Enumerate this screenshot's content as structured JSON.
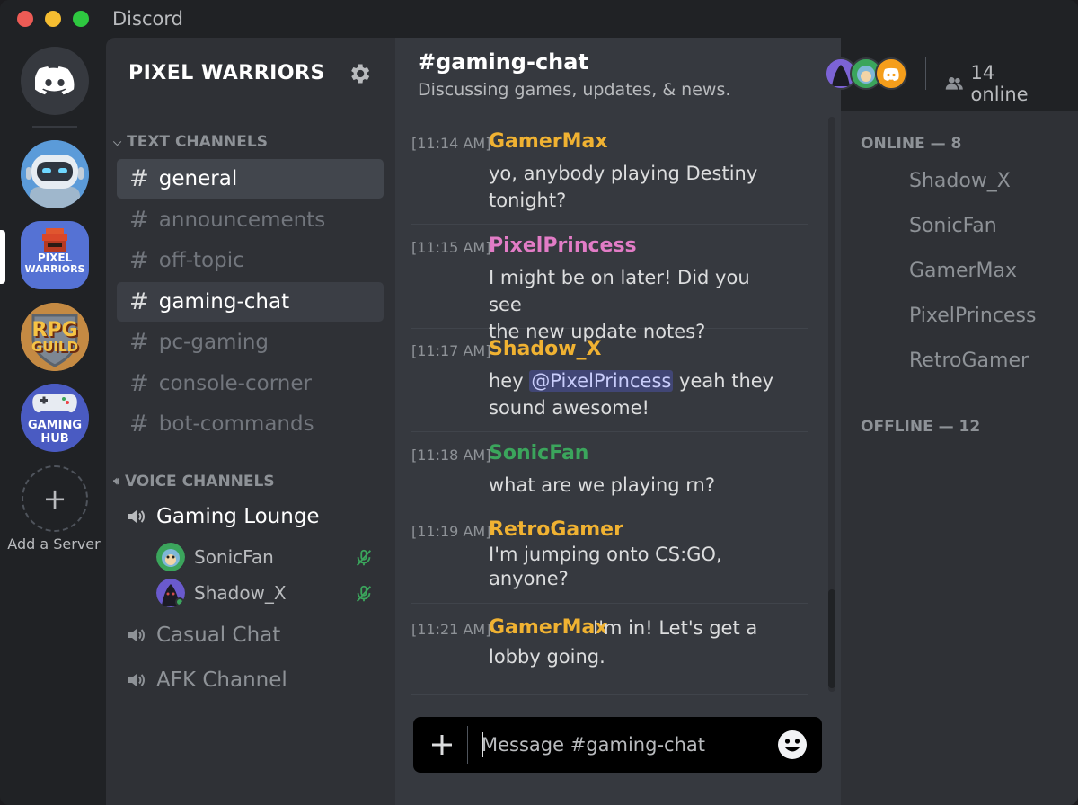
{
  "titlebar": {
    "app_title": "Discord"
  },
  "servers": {
    "pixel_label_1": "PIXEL",
    "pixel_label_2": "WARRIORS",
    "rpg_label_1": "RPG",
    "rpg_label_2": "GUILD",
    "hub_label_1": "GAMING",
    "hub_label_2": "HUB",
    "add_label": "Add a Server"
  },
  "guild": {
    "name": "PIXEL WARRIORS"
  },
  "categories": {
    "text": "TEXT CHANNELS",
    "voice": "VOICE CHANNELS"
  },
  "text_channels": [
    {
      "name": "general",
      "state": "selected"
    },
    {
      "name": "announcements",
      "state": "muted"
    },
    {
      "name": "off-topic",
      "state": "muted"
    },
    {
      "name": "gaming-chat",
      "state": "active"
    },
    {
      "name": "pc-gaming",
      "state": "muted"
    },
    {
      "name": "console-corner",
      "state": "muted"
    },
    {
      "name": "bot-commands",
      "state": "muted"
    }
  ],
  "voice_channels": [
    {
      "name": "Gaming Lounge",
      "users": [
        "SonicFan",
        "Shadow_X"
      ]
    },
    {
      "name": "Casual Chat"
    },
    {
      "name": "AFK Channel"
    }
  ],
  "chat": {
    "title": "#gaming-chat",
    "topic": "Discussing games, updates, & news.",
    "online_count": "14 online",
    "messages": [
      {
        "time": "[11:14 AM]",
        "author": "GamerMax",
        "color": "#f0b232",
        "lines": [
          "yo, anybody playing Destiny",
          "tonight?"
        ]
      },
      {
        "time": "[11:15 AM]",
        "author": "PixelPrincess",
        "color": "#e27cc6",
        "lines": [
          "I might be on later! Did you see",
          "the new update notes?"
        ]
      },
      {
        "time": "[11:17 AM]",
        "author": "Shadow_X",
        "color": "#f0b232",
        "before_mention": "hey ",
        "mention": "@PixelPrincess",
        "after_mention": " yeah they",
        "line2": "sound awesome!"
      },
      {
        "time": "[11:18 AM]",
        "author": "SonicFan",
        "color": "#3ba55c",
        "lines": [
          "what are we playing rn?"
        ]
      },
      {
        "time": "[11:19 AM]",
        "author": "RetroGamer",
        "color": "#f0b232",
        "lines": [
          "I'm jumping onto CS:GO,",
          "anyone?"
        ]
      },
      {
        "time": "[11:21 AM]",
        "author": "GamerMax",
        "color": "#f0b232",
        "inline": "I'm in! Let's get a",
        "line2": "lobby going."
      }
    ],
    "composer_placeholder": "Message #gaming-chat"
  },
  "members": {
    "online_header": "ONLINE — 8",
    "online": [
      "Shadow_X",
      "SonicFan",
      "GamerMax",
      "PixelPrincess",
      "RetroGamer"
    ],
    "offline_header": "OFFLINE — 12"
  },
  "colors": {
    "mention_bg": "#414675",
    "online_green": "#3ba55c",
    "accent_orange": "#f0b232",
    "pink": "#e27cc6"
  }
}
